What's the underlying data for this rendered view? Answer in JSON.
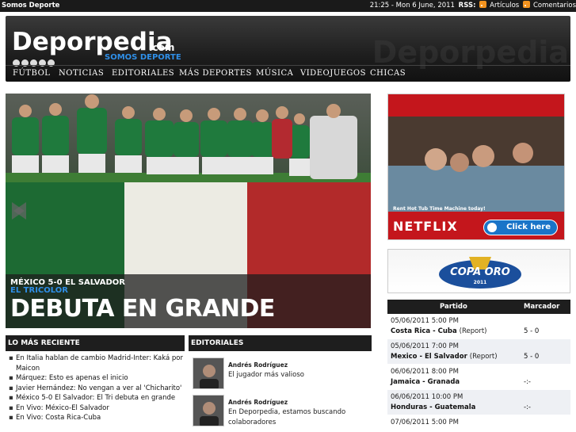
{
  "topbar": {
    "site": "Somos Deporte",
    "datetime": "21:25 - Mon 6 June, 2011",
    "rss_label": "RSS:",
    "rss_articles": "Artículos",
    "rss_comments": "Comentarios"
  },
  "header": {
    "logo": "Deporpedia",
    "logo_com": ".com",
    "tagline": "SOMOS DEPORTE",
    "watermark": "Deporpedia",
    "nav": [
      "FÚTBOL",
      "NOTICIAS",
      "EDITORIALES",
      "MÁS DEPORTES",
      "MÚSICA",
      "VIDEOJUEGOS",
      "CHICAS"
    ]
  },
  "slider": {
    "kicker": "MÉXICO 5-0 EL SALVADOR",
    "subtitle": "EL TRICOLOR",
    "title": "DEBUTA EN GRANDE"
  },
  "recent": {
    "heading": "LO MÁS RECIENTE",
    "items": [
      "En Italia hablan de cambio Madrid-Inter: Kaká por Maicon",
      "Márquez: Esto es apenas el inicio",
      "Javier Hernández: No vengan a ver al 'Chicharito'",
      "México 5-0 El Salvador: El Tri debuta en grande",
      "En Vivo: México-El Salvador",
      "En Vivo: Costa Rica-Cuba"
    ]
  },
  "editorials": {
    "heading": "EDITORIALES",
    "items": [
      {
        "author": "Andrés Rodríguez",
        "text": "El jugador más valioso"
      },
      {
        "author": "Andrés Rodríguez",
        "text": "En Deporpedia, estamos buscando colaboradores"
      }
    ]
  },
  "ad": {
    "caption": "Rent Hot Tub Time Machine today!",
    "brand": "NETFLIX",
    "cta": "Click here"
  },
  "copa": {
    "title": "COPA ORO",
    "year": "2011"
  },
  "scores": {
    "col_match": "Partido",
    "col_score": "Marcador",
    "rows": [
      {
        "date": "05/06/2011 5:00 PM",
        "match": "Costa Rica - Cuba",
        "report": "(Report)",
        "score": "5 - 0"
      },
      {
        "date": "05/06/2011 7:00 PM",
        "match": "Mexico - El Salvador",
        "report": "(Report)",
        "score": "5 - 0"
      },
      {
        "date": "06/06/2011 8:00 PM",
        "match": "Jamaica - Granada",
        "report": "",
        "score": "-:-"
      },
      {
        "date": "06/06/2011 10:00 PM",
        "match": "Honduras - Guatemala",
        "report": "",
        "score": "-:-"
      },
      {
        "date": "07/06/2011 5:00 PM",
        "match": "",
        "report": "",
        "score": ""
      }
    ]
  },
  "colors": {
    "accent_blue": "#2f8fe8",
    "header_dark": "#1e1e1e",
    "rss_orange": "#f3931f",
    "netflix_red": "#c4161c"
  }
}
